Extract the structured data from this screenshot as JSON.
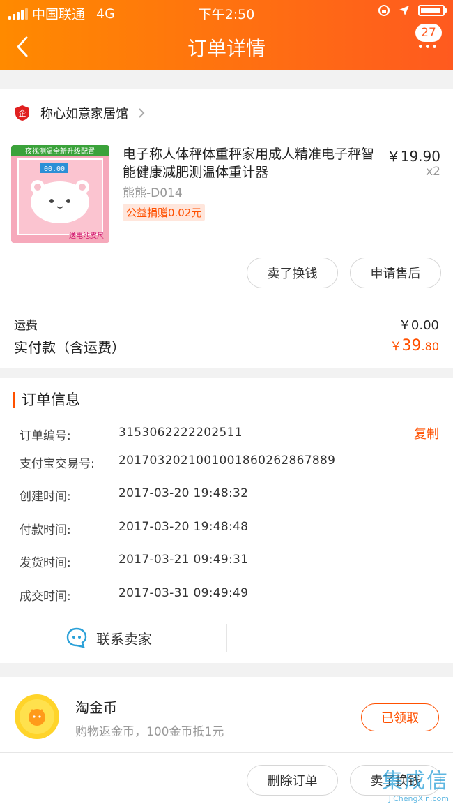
{
  "status_bar": {
    "carrier": "中国联通",
    "network": "4G",
    "time": "下午2:50",
    "battery_level": 0.9
  },
  "nav": {
    "title": "订单详情",
    "badge_count": "27"
  },
  "shop": {
    "name": "称心如意家居馆",
    "logo_char": "企"
  },
  "product": {
    "title": "电子称人体秤体重秤家用成人精准电子秤智能健康减肥测温体重计器",
    "sku": "熊熊-D014",
    "tag": "公益捐赠0.02元",
    "price": "￥19.90",
    "qty": "x2",
    "image_banner": "夜视测温全新升级配置",
    "image_footer": "送电池皮尺",
    "image_screen": "00.00"
  },
  "actions": {
    "sell": "卖了换钱",
    "after_sale": "申请售后"
  },
  "fees": {
    "shipping_label": "运费",
    "shipping_value": "￥0.00",
    "paid_label": "实付款（含运费）",
    "paid_yen": "￥",
    "paid_int": "39",
    "paid_dec": ".80"
  },
  "order_info": {
    "title": "订单信息",
    "copy_label": "复制",
    "rows": [
      {
        "k": "订单编号:",
        "v": "3153062222202511"
      },
      {
        "k": "支付宝交易号:",
        "v": "2017032021001001860262867889"
      },
      {
        "k": "创建时间:",
        "v": "2017-03-20 19:48:32"
      },
      {
        "k": "付款时间:",
        "v": "2017-03-20 19:48:48"
      },
      {
        "k": "发货时间:",
        "v": "2017-03-21 09:49:31"
      },
      {
        "k": "成交时间:",
        "v": "2017-03-31 09:49:49"
      }
    ]
  },
  "contact": {
    "label": "联系卖家"
  },
  "coin": {
    "title": "淘金币",
    "sub": "购物返金币，100金币抵1元",
    "button": "已领取"
  },
  "bottom": {
    "delete": "删除订单",
    "sell": "卖了换钱"
  },
  "watermark": {
    "text": "集成信",
    "url": "JiChengXin.com"
  },
  "colors": {
    "accent": "#ff5000",
    "header_start": "#ff8a00",
    "header_end": "#ff5a1f"
  }
}
